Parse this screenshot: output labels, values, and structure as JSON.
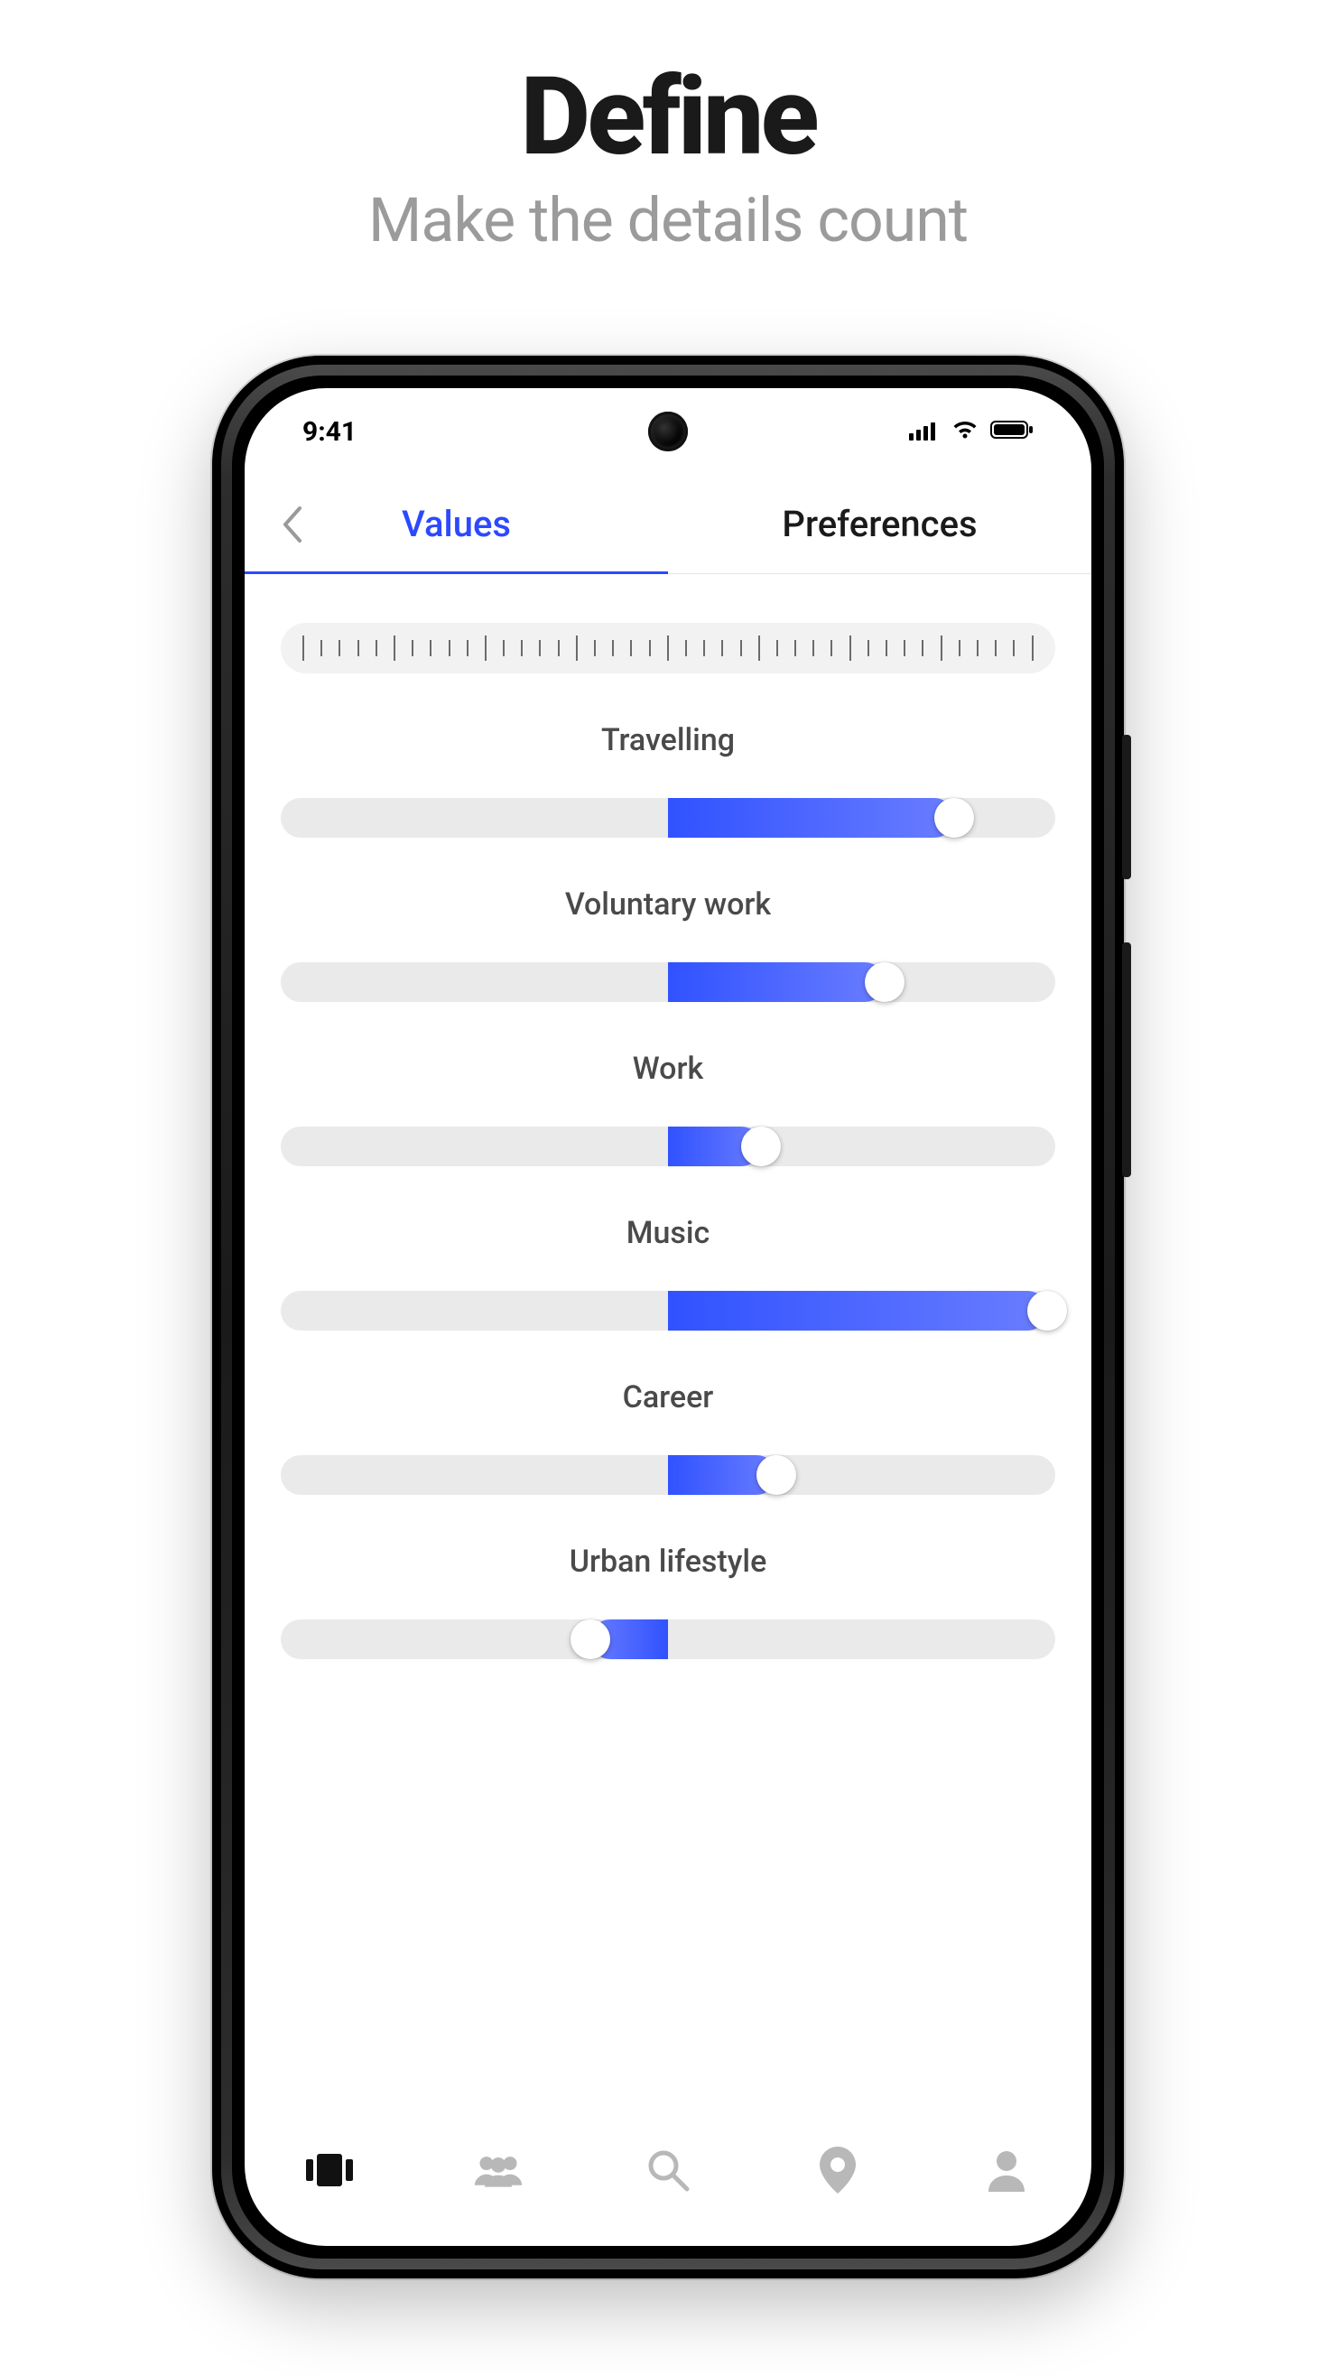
{
  "hero": {
    "title": "Define",
    "subtitle": "Make the details count"
  },
  "statusbar": {
    "time": "9:41"
  },
  "header": {
    "tabs": [
      {
        "label": "Values",
        "active": true
      },
      {
        "label": "Preferences",
        "active": false
      }
    ]
  },
  "app": {
    "sliders": [
      {
        "label": "Travelling",
        "start": 50,
        "end": 87,
        "thumbAt": "end"
      },
      {
        "label": "Voluntary work",
        "start": 50,
        "end": 78,
        "thumbAt": "end"
      },
      {
        "label": "Work",
        "start": 50,
        "end": 62,
        "thumbAt": "end"
      },
      {
        "label": "Music",
        "start": 50,
        "end": 99,
        "thumbAt": "end"
      },
      {
        "label": "Career",
        "start": 50,
        "end": 64,
        "thumbAt": "end"
      },
      {
        "label": "Urban lifestyle",
        "start": 40,
        "end": 50,
        "thumbAt": "start"
      }
    ]
  },
  "bottomNav": {
    "items": [
      {
        "icon": "stack-icon",
        "label": "",
        "active": true
      },
      {
        "icon": "people-icon",
        "label": "",
        "active": false
      },
      {
        "icon": "search-icon",
        "label": "",
        "active": false
      },
      {
        "icon": "location-icon",
        "label": "",
        "active": false
      },
      {
        "icon": "profile-icon",
        "label": "",
        "active": false
      }
    ]
  },
  "colors": {
    "accent": "#2c49ff",
    "track": "#eaeaea",
    "textMuted": "#9b9b9b"
  }
}
